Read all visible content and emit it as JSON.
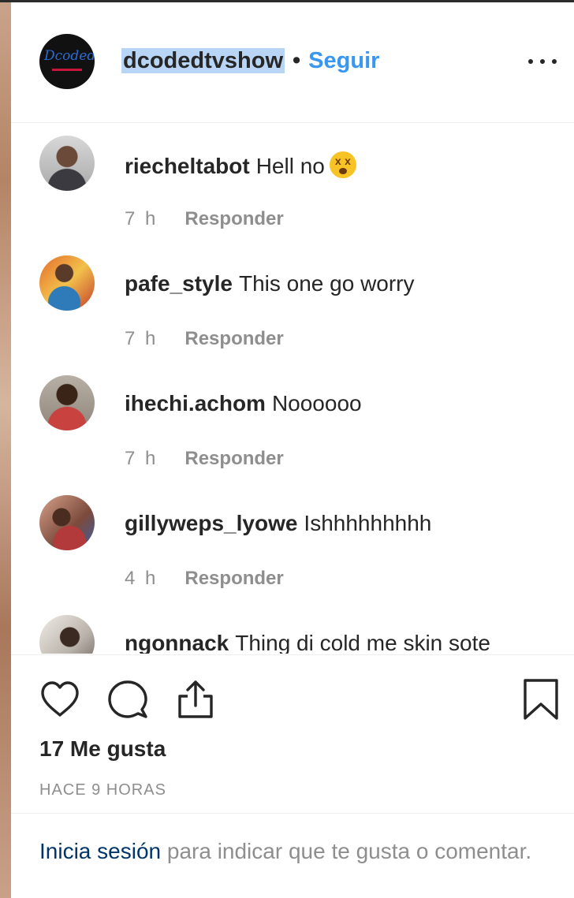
{
  "post": {
    "username": "dcodedtvshow",
    "separator": "•",
    "follow_label": "Seguir"
  },
  "comments": [
    {
      "user": "riecheltabot",
      "text": "Hell no",
      "emoji": "dizzy-face-emoji",
      "time": "7 h",
      "reply": "Responder"
    },
    {
      "user": "pafe_style",
      "text": "This one go worry",
      "time": "7 h",
      "reply": "Responder"
    },
    {
      "user": "ihechi.achom",
      "text": "Noooooo",
      "time": "7 h",
      "reply": "Responder"
    },
    {
      "user": "gillyweps_lyowe",
      "text": "Ishhhhhhhhh",
      "time": "4 h",
      "reply": "Responder"
    },
    {
      "user": "ngonnack",
      "text": "Thing di cold me skin sote"
    }
  ],
  "actions": {
    "likes": "17 Me gusta",
    "timestamp": "HACE 9 HORAS",
    "icons": [
      "heart-icon",
      "comment-icon",
      "share-icon",
      "bookmark-icon"
    ]
  },
  "footer": {
    "login_link": "Inicia sesión",
    "rest": " para indicar que te gusta o comentar."
  },
  "colors": {
    "link_blue": "#3897f0",
    "login_blue": "#003569",
    "muted": "#8e8e8e",
    "highlight": "#b9d5f5"
  }
}
